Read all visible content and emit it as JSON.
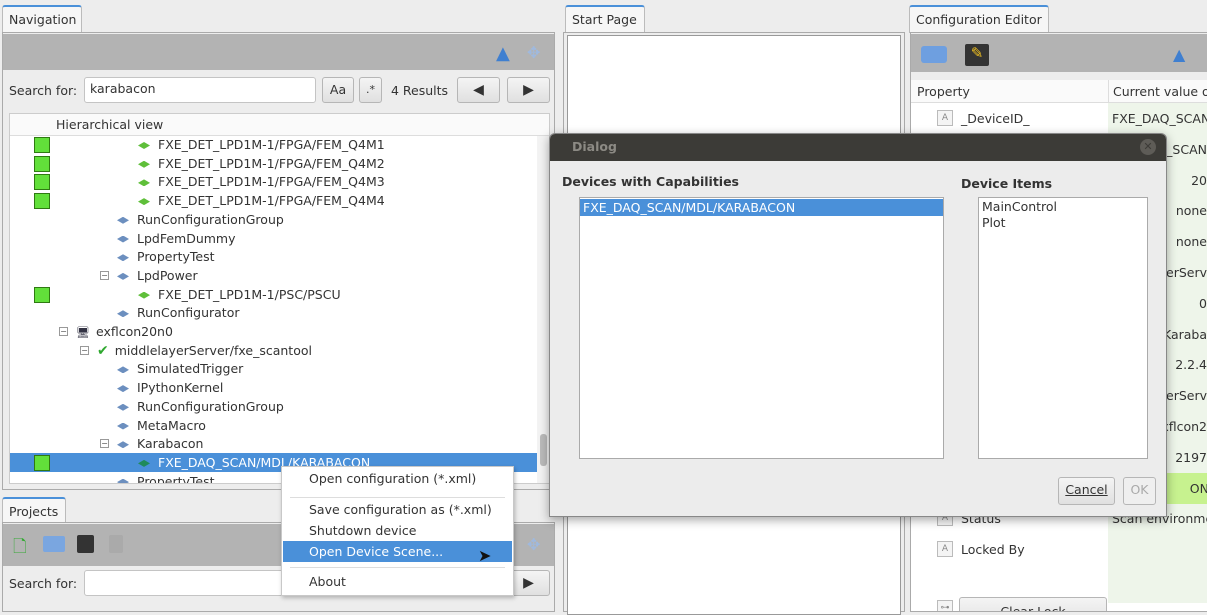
{
  "navigation": {
    "tab": "Navigation",
    "search_label": "Search for:",
    "search_value": "karabacon",
    "case_button": "Aa",
    "regex_button": ".*",
    "results": "4 Results",
    "prev_icon": "arrow-left",
    "next_icon": "arrow-right",
    "tree_header": "Hierarchical view",
    "tree": [
      {
        "label": "FXE_DET_LPD1M-1/FPGA/FEM_Q4M1",
        "status": true,
        "icon": "green-diamond"
      },
      {
        "label": "FXE_DET_LPD1M-1/FPGA/FEM_Q4M2",
        "status": true,
        "icon": "green-diamond"
      },
      {
        "label": "FXE_DET_LPD1M-1/FPGA/FEM_Q4M3",
        "status": true,
        "icon": "green-diamond"
      },
      {
        "label": "FXE_DET_LPD1M-1/FPGA/FEM_Q4M4",
        "status": true,
        "icon": "green-diamond"
      },
      {
        "label": "RunConfigurationGroup",
        "icon": "blue-diamond"
      },
      {
        "label": "LpdFemDummy",
        "icon": "blue-diamond"
      },
      {
        "label": "PropertyTest",
        "icon": "blue-diamond"
      },
      {
        "label": "LpdPower",
        "icon": "blue-diamond",
        "expander": "−"
      },
      {
        "label": "FXE_DET_LPD1M-1/PSC/PSCU",
        "status": true,
        "icon": "green-diamond"
      },
      {
        "label": "RunConfigurator",
        "icon": "blue-diamond"
      },
      {
        "label": "exflcon20n0",
        "icon": "computer",
        "expander": "−"
      },
      {
        "label": "middlelayerServer/fxe_scantool",
        "icon": "check",
        "expander": "−"
      },
      {
        "label": "SimulatedTrigger",
        "icon": "blue-diamond"
      },
      {
        "label": "IPythonKernel",
        "icon": "blue-diamond"
      },
      {
        "label": "RunConfigurationGroup",
        "icon": "blue-diamond"
      },
      {
        "label": "MetaMacro",
        "icon": "blue-diamond"
      },
      {
        "label": "Karabacon",
        "icon": "blue-diamond",
        "expander": "−"
      },
      {
        "label": "FXE_DAQ_SCAN/MDL/KARABACON",
        "status": true,
        "icon": "device",
        "selected": true
      },
      {
        "label": "PropertyTest",
        "icon": "blue-diamond"
      }
    ]
  },
  "projects": {
    "tab": "Projects",
    "search_label": "Search for:",
    "search_value": ""
  },
  "start_page": {
    "tab": "Start Page"
  },
  "config_editor": {
    "tab": "Configuration Editor",
    "col_property": "Property",
    "col_value": "Current value o",
    "rows": [
      {
        "property": "_DeviceID_",
        "value": "FXE_DAQ_SCAN"
      },
      {
        "property": "",
        "value": "_SCAN"
      },
      {
        "property": "",
        "value": "20"
      },
      {
        "property": "",
        "value": "none"
      },
      {
        "property": "",
        "value": "none"
      },
      {
        "property": "",
        "value": "verServ"
      },
      {
        "property": "",
        "value": "0"
      },
      {
        "property": "",
        "value": "Karaba"
      },
      {
        "property": "",
        "value": "2.2.4"
      },
      {
        "property": "",
        "value": "verServ"
      },
      {
        "property": "",
        "value": "xflcon2"
      },
      {
        "property": "",
        "value": "2197"
      },
      {
        "property": "",
        "value": "ON"
      },
      {
        "property": "Status",
        "value": "Scan environme"
      },
      {
        "property": "Locked By",
        "value": ""
      }
    ],
    "clear_lock": "Clear Lock"
  },
  "dialog": {
    "title": "Dialog",
    "left_header": "Devices with Capabilities",
    "left_items": [
      "FXE_DAQ_SCAN/MDL/KARABACON"
    ],
    "right_header": "Device Items",
    "right_items": [
      "MainControl",
      "Plot"
    ],
    "cancel": "Cancel",
    "ok": "OK"
  },
  "context_menu": {
    "items": [
      "Open configuration (*.xml)",
      "Save configuration as (*.xml)",
      "Shutdown device",
      "Open Device Scene...",
      "About"
    ],
    "highlighted": "Open Device Scene..."
  },
  "colors": {
    "accent": "#4a90d9",
    "status_green": "#62e03a",
    "toolbar": "#b3b3b3",
    "on_state": "#c7f28f"
  }
}
